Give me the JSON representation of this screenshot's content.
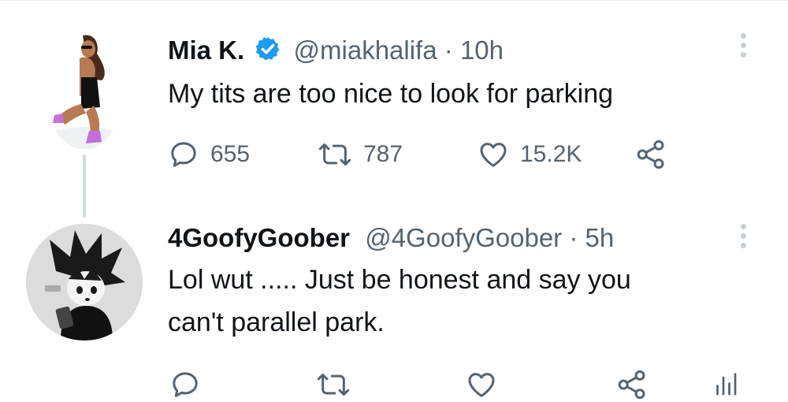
{
  "tweets": [
    {
      "name": "Mia K.",
      "handle": "@miakhalifa",
      "separator": "·",
      "time": "10h",
      "verified": true,
      "text_lines": [
        "My tits are too nice to look for parking"
      ],
      "replies": "655",
      "retweets": "787",
      "likes": "15.2K"
    },
    {
      "name": "4GoofyGoober",
      "handle": "@4GoofyGoober",
      "separator": "·",
      "time": "5h",
      "verified": false,
      "text_lines": [
        "Lol wut ..... Just be honest and say you",
        "can't parallel park."
      ]
    }
  ],
  "colors": {
    "verified": "#1d9bf0",
    "secondary_text": "#536471",
    "thread_line": "#cfd9de",
    "action_icon": "#536471"
  },
  "icons": [
    "verified-icon",
    "more-icon",
    "reply-icon",
    "retweet-icon",
    "like-icon",
    "share-icon",
    "analytics-icon"
  ]
}
